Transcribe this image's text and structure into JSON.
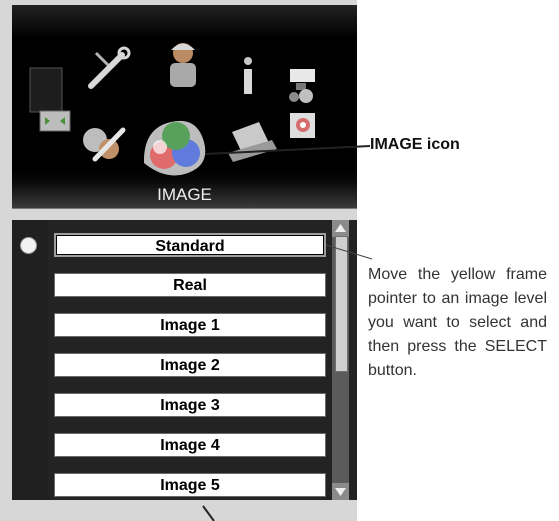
{
  "callouts": {
    "image_icon_label": "IMAGE icon",
    "instruction": "Move the yellow frame pointer to an image level you want to select and then press the SELECT button."
  },
  "menu": {
    "title": "IMAGE",
    "items": [
      {
        "label": "Standard",
        "selected": true
      },
      {
        "label": "Real",
        "selected": false
      },
      {
        "label": "Image 1",
        "selected": false
      },
      {
        "label": "Image 2",
        "selected": false
      },
      {
        "label": "Image 3",
        "selected": false
      },
      {
        "label": "Image 4",
        "selected": false
      },
      {
        "label": "Image 5",
        "selected": false
      }
    ]
  },
  "icons": [
    "display-icon",
    "tools-icon",
    "user-icon",
    "info-icon",
    "input-icon",
    "adjust-icon",
    "image-icon",
    "laptop-icon",
    "settings-icon"
  ]
}
